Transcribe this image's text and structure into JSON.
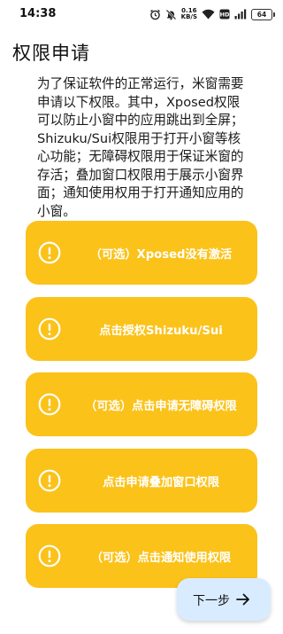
{
  "status_bar": {
    "time": "14:38",
    "net_speed_value": "0.16",
    "net_speed_unit": "KB/S",
    "sim_label": "HD",
    "battery_level": "64"
  },
  "page": {
    "title": "权限申请",
    "description": "为了保证软件的正常运行，米窗需要申请以下权限。其中，Xposed权限可以防止小窗中的应用跳出到全屏；Shizuku/Sui权限用于打开小窗等核心功能；无障碍权限用于保证米窗的存活；叠加窗口权限用于展示小窗界面；通知使用权用于打开通知应用的小窗。"
  },
  "permissions": [
    {
      "label": "（可选）Xposed没有激活",
      "icon": "exclamation-circle-icon"
    },
    {
      "label": "点击授权Shizuku/Sui",
      "icon": "exclamation-circle-icon"
    },
    {
      "label": "（可选）点击申请无障碍权限",
      "icon": "exclamation-circle-icon"
    },
    {
      "label": "点击申请叠加窗口权限",
      "icon": "exclamation-circle-icon"
    },
    {
      "label": "（可选）点击通知使用权限",
      "icon": "exclamation-circle-icon"
    }
  ],
  "next_button": {
    "label": "下一步",
    "icon": "arrow-right-icon"
  },
  "colors": {
    "card_background": "#fbc21a",
    "card_text": "#ffffff",
    "fab_background": "#d9ecff"
  }
}
